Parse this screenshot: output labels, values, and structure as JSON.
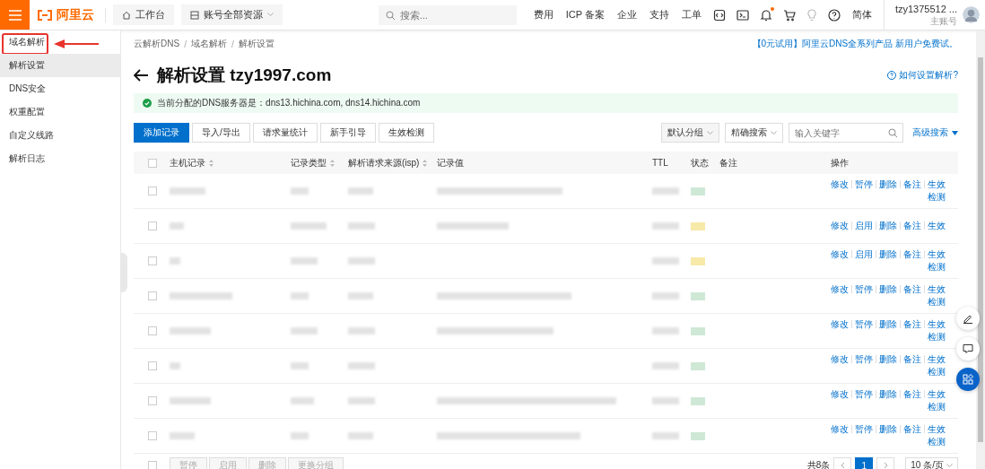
{
  "header": {
    "logo": "阿里云",
    "workbench": "工作台",
    "resources": "账号全部资源",
    "search": {
      "placeholder": "搜索..."
    },
    "nav": [
      "费用",
      "ICP 备案",
      "企业",
      "支持",
      "工单"
    ],
    "icons": [
      {
        "kind": "code",
        "dot": false
      },
      {
        "kind": "terminal",
        "dot": false
      },
      {
        "kind": "bell",
        "dot": true
      },
      {
        "kind": "cart",
        "dot": false
      },
      {
        "kind": "bulb",
        "dot": false
      },
      {
        "kind": "help",
        "dot": false
      }
    ],
    "language": "简体",
    "user": {
      "name": "tzy1375512 ...",
      "role": "主账号"
    }
  },
  "sidebar": {
    "items": [
      {
        "label": "域名解析",
        "selected": false,
        "annotated": true
      },
      {
        "label": "解析设置",
        "selected": true,
        "annotated": false
      },
      {
        "label": "DNS安全",
        "selected": false,
        "annotated": false
      },
      {
        "label": "权重配置",
        "selected": false,
        "annotated": false
      },
      {
        "label": "自定义线路",
        "selected": false,
        "annotated": false
      },
      {
        "label": "解析日志",
        "selected": false,
        "annotated": false
      }
    ]
  },
  "breadcrumb": {
    "items": [
      "云解析DNS",
      "域名解析",
      "解析设置"
    ],
    "separators": [
      "/",
      "/"
    ]
  },
  "promo": "【0元试用】阿里云DNS全系列产品 新用户免费试。",
  "title": "解析设置 tzy1997.com",
  "help_link": "如何设置解析?",
  "alert": "当前分配的DNS服务器是：dns13.hichina.com, dns14.hichina.com",
  "toolbar": {
    "buttons": [
      {
        "label": "添加记录",
        "primary": true
      },
      {
        "label": "导入/导出",
        "primary": false
      },
      {
        "label": "请求量统计",
        "primary": false
      },
      {
        "label": "新手引导",
        "primary": false
      },
      {
        "label": "生效检测",
        "primary": false
      }
    ],
    "group": "默认分组",
    "search_mode": "精确搜索",
    "keyword": {
      "placeholder": "输入关键字"
    },
    "advanced": "高级搜索"
  },
  "table": {
    "all_checked": false,
    "columns": [
      {
        "label": "主机记录",
        "sortable": true
      },
      {
        "label": "记录类型",
        "sortable": true
      },
      {
        "label": "解析请求来源(isp)",
        "sortable": true
      },
      {
        "label": "记录值",
        "sortable": false
      },
      {
        "label": "TTL",
        "sortable": false
      },
      {
        "label": "状态",
        "sortable": false
      },
      {
        "label": "备注",
        "sortable": false
      },
      {
        "label": "操作",
        "sortable": false
      }
    ],
    "rows": [
      {
        "checked": false,
        "enabled": true,
        "actions": [
          "修改",
          "暂停",
          "删除",
          "备注",
          "生效检测"
        ]
      },
      {
        "checked": false,
        "enabled": false,
        "actions": [
          "修改",
          "启用",
          "删除",
          "备注",
          "生效"
        ]
      },
      {
        "checked": false,
        "enabled": false,
        "actions": [
          "修改",
          "启用",
          "删除",
          "备注",
          "生效检测"
        ]
      },
      {
        "checked": false,
        "enabled": true,
        "actions": [
          "修改",
          "暂停",
          "删除",
          "备注",
          "生效检测"
        ]
      },
      {
        "checked": false,
        "enabled": true,
        "actions": [
          "修改",
          "暂停",
          "删除",
          "备注",
          "生效检测"
        ]
      },
      {
        "checked": false,
        "enabled": true,
        "actions": [
          "修改",
          "暂停",
          "删除",
          "备注",
          "生效检测"
        ]
      },
      {
        "checked": false,
        "enabled": true,
        "actions": [
          "修改",
          "暂停",
          "删除",
          "备注",
          "生效检测"
        ]
      },
      {
        "checked": false,
        "enabled": true,
        "actions": [
          "修改",
          "暂停",
          "删除",
          "备注",
          "生效检测"
        ]
      }
    ]
  },
  "footer": {
    "checked": false,
    "batch": [
      "暂停",
      "启用",
      "删除",
      "更换分组"
    ],
    "total": "共8条",
    "pages": [
      {
        "label": "1",
        "selected": true
      }
    ],
    "page_size": "10 条/页"
  }
}
